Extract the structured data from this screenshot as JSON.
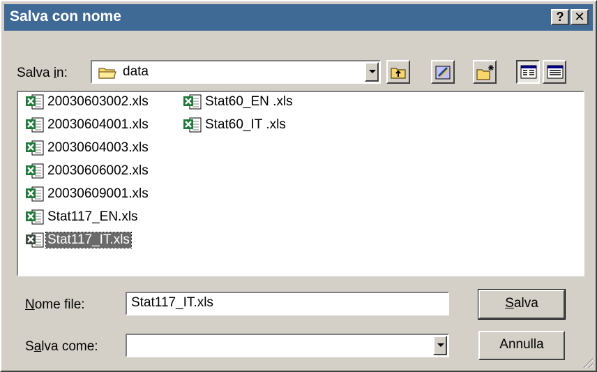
{
  "window": {
    "title": "Salva con nome",
    "help_label": "?",
    "close_label": "✕"
  },
  "location": {
    "label_prefix": "Salva ",
    "label_accel": "i",
    "label_suffix": "n:",
    "current_folder": "data",
    "folder_icon": "folder-icon"
  },
  "toolbar": {
    "buttons": [
      {
        "name": "up-one-level-button",
        "icon": "folder-up-icon"
      },
      {
        "name": "go-to-desktop-button",
        "icon": "desktop-icon"
      },
      {
        "name": "new-folder-button",
        "icon": "new-folder-icon"
      },
      {
        "name": "list-view-button",
        "icon": "list-view-icon",
        "pressed": true
      },
      {
        "name": "details-view-button",
        "icon": "details-view-icon"
      }
    ]
  },
  "files": [
    {
      "name": "20030603002.xls"
    },
    {
      "name": "20030604001.xls"
    },
    {
      "name": "20030604003.xls"
    },
    {
      "name": "20030606002.xls"
    },
    {
      "name": "20030609001.xls"
    },
    {
      "name": "Stat117_EN.xls"
    },
    {
      "name": "Stat117_IT.xls",
      "selected": true
    },
    {
      "name": "Stat60_EN .xls"
    },
    {
      "name": "Stat60_IT .xls"
    }
  ],
  "form": {
    "filename_label_accel": "N",
    "filename_label_rest": "ome file:",
    "filename_value": "Stat117_IT.xls",
    "type_label_pre": "S",
    "type_label_accel": "a",
    "type_label_rest": "lva come:",
    "type_value": ""
  },
  "buttons": {
    "save_accel": "S",
    "save_rest": "alva",
    "cancel_label": "Annulla"
  },
  "colors": {
    "titlebar": "#406a96",
    "selection": "#6a6a6a",
    "face": "#d4d0c8",
    "excel_green": "#1f7a3a"
  }
}
